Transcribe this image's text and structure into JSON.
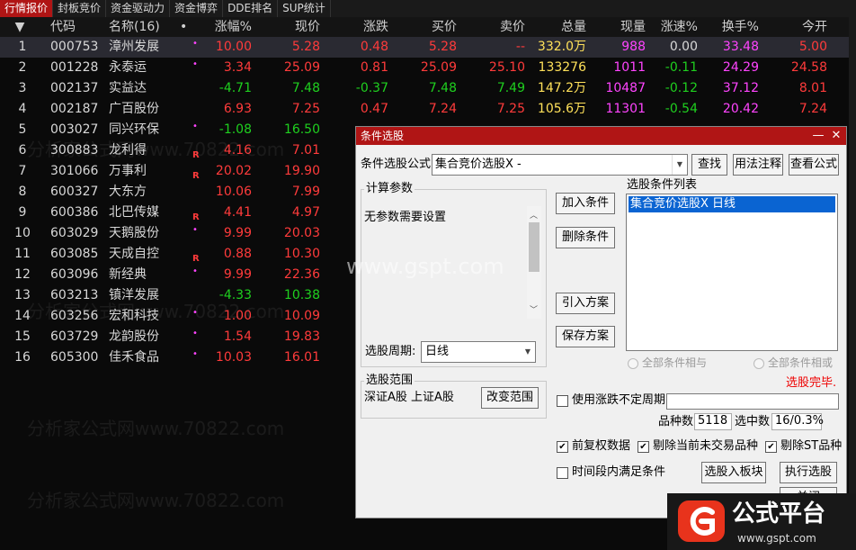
{
  "tabs": [
    {
      "label": "行情报价",
      "active": true
    },
    {
      "label": "封板竞价"
    },
    {
      "label": "资金驱动力"
    },
    {
      "label": "资金博弈"
    },
    {
      "label": "DDE排名"
    },
    {
      "label": "SUP统计"
    }
  ],
  "table": {
    "headers": {
      "sort": "▼",
      "code": "代码",
      "name": "名称(16)",
      "dot": "•",
      "change_pct": "涨幅%",
      "price": "现价",
      "change": "涨跌",
      "bid": "买价",
      "ask": "卖价",
      "volume": "总量",
      "cur_vol": "现量",
      "speed": "涨速%",
      "turnover": "换手%",
      "open": "今开"
    },
    "rows": [
      {
        "no": "1",
        "code": "000753",
        "name": "漳州发展",
        "flag": "•",
        "change_pct": "10.00",
        "price": "5.28",
        "change": "0.48",
        "bid": "5.28",
        "ask": "--",
        "volume": "332.0万",
        "cur_vol": "988",
        "speed": "0.00",
        "turnover": "33.48",
        "open": "5.00",
        "tone": "red",
        "speed_tone": "white",
        "open_tone": "red"
      },
      {
        "no": "2",
        "code": "001228",
        "name": "永泰运",
        "flag": "•",
        "change_pct": "3.34",
        "price": "25.09",
        "change": "0.81",
        "bid": "25.09",
        "ask": "25.10",
        "volume": "133276",
        "cur_vol": "1011",
        "speed": "-0.11",
        "turnover": "24.29",
        "open": "24.58",
        "tone": "red",
        "speed_tone": "green",
        "open_tone": "red"
      },
      {
        "no": "3",
        "code": "002137",
        "name": "实益达",
        "flag": "",
        "change_pct": "-4.71",
        "price": "7.48",
        "change": "-0.37",
        "bid": "7.48",
        "ask": "7.49",
        "volume": "147.2万",
        "cur_vol": "10487",
        "speed": "-0.12",
        "turnover": "37.12",
        "open": "8.01",
        "tone": "green",
        "speed_tone": "green",
        "open_tone": "red"
      },
      {
        "no": "4",
        "code": "002187",
        "name": "广百股份",
        "flag": "",
        "change_pct": "6.93",
        "price": "7.25",
        "change": "0.47",
        "bid": "7.24",
        "ask": "7.25",
        "volume": "105.6万",
        "cur_vol": "11301",
        "speed": "-0.54",
        "turnover": "20.42",
        "open": "7.24",
        "tone": "red",
        "speed_tone": "green",
        "open_tone": "red"
      },
      {
        "no": "5",
        "code": "003027",
        "name": "同兴环保",
        "flag": "•",
        "change_pct": "-1.08",
        "price": "16.50",
        "change": "",
        "bid": "",
        "ask": "",
        "volume": "",
        "cur_vol": "",
        "speed": "",
        "turnover": "",
        "open": "",
        "tone": "green",
        "speed_tone": "green",
        "open_tone": "red"
      },
      {
        "no": "6",
        "code": "300883",
        "name": "龙利得",
        "flag": "R",
        "change_pct": "4.16",
        "price": "7.01",
        "tone": "red"
      },
      {
        "no": "7",
        "code": "301066",
        "name": "万事利",
        "flag": "R",
        "change_pct": "20.02",
        "price": "19.90",
        "tone": "red"
      },
      {
        "no": "8",
        "code": "600327",
        "name": "大东方",
        "flag": "",
        "change_pct": "10.06",
        "price": "7.99",
        "tone": "red"
      },
      {
        "no": "9",
        "code": "600386",
        "name": "北巴传媒",
        "flag": "R",
        "change_pct": "4.41",
        "price": "4.97",
        "tone": "red"
      },
      {
        "no": "10",
        "code": "603029",
        "name": "天鹅股份",
        "flag": "•",
        "change_pct": "9.99",
        "price": "20.03",
        "tone": "red"
      },
      {
        "no": "11",
        "code": "603085",
        "name": "天成自控",
        "flag": "R",
        "change_pct": "0.88",
        "price": "10.30",
        "tone": "red"
      },
      {
        "no": "12",
        "code": "603096",
        "name": "新经典",
        "flag": "•",
        "change_pct": "9.99",
        "price": "22.36",
        "tone": "red"
      },
      {
        "no": "13",
        "code": "603213",
        "name": "镇洋发展",
        "flag": "",
        "change_pct": "-4.33",
        "price": "10.38",
        "tone": "green"
      },
      {
        "no": "14",
        "code": "603256",
        "name": "宏和科技",
        "flag": "•",
        "change_pct": "1.00",
        "price": "10.09",
        "tone": "red"
      },
      {
        "no": "15",
        "code": "603729",
        "name": "龙韵股份",
        "flag": "•",
        "change_pct": "1.54",
        "price": "19.83",
        "tone": "red"
      },
      {
        "no": "16",
        "code": "605300",
        "name": "佳禾食品",
        "flag": "•",
        "change_pct": "10.03",
        "price": "16.01",
        "tone": "red"
      }
    ]
  },
  "watermarks": [
    "www.gspt.com",
    "分析家公式网www.70822.com"
  ],
  "dialog": {
    "title": "条件选股",
    "min_icon": "—",
    "close_icon": "✕",
    "formula_label": "条件选股公式",
    "formula_value": "集合竞价选股X  -",
    "dropdown_arrow": "▼",
    "btn_find": "查找",
    "btn_usage": "用法注释",
    "btn_view": "查看公式",
    "calc_group": "计算参数",
    "calc_text": "无参数需要设置",
    "period_label": "选股周期:",
    "period_value": "日线",
    "btn_add": "加入条件",
    "btn_del": "删除条件",
    "btn_import": "引入方案",
    "btn_save": "保存方案",
    "list_label": "选股条件列表",
    "list_items": [
      "集合竞价选股X  日线"
    ],
    "radio_and": "全部条件相与",
    "radio_or": "全部条件相或",
    "status": "选股完毕.",
    "range_group": "选股范围",
    "range_text": "深证A股 上证A股",
    "btn_range": "改变范围",
    "cb_uncertain": "使用涨跌不定周期",
    "total_label": "品种数",
    "total_value": "5118",
    "selected_label": "选中数",
    "selected_value": "16/0.3%",
    "cb_fq": "前复权数据",
    "cb_excl_notrade": "剔除当前未交易品种",
    "cb_excl_st": "剔除ST品种",
    "cb_time": "时间段内满足条件",
    "btn_to_block": "选股入板块",
    "btn_run": "执行选股",
    "btn_close": "关闭"
  },
  "logo": {
    "text": "公式平台",
    "url_text": "www.gspt.com",
    "accent": "#e8331c"
  },
  "colors": {
    "up": "#ff3b3b",
    "down": "#1fd01f",
    "tab_active": "#b01515"
  }
}
